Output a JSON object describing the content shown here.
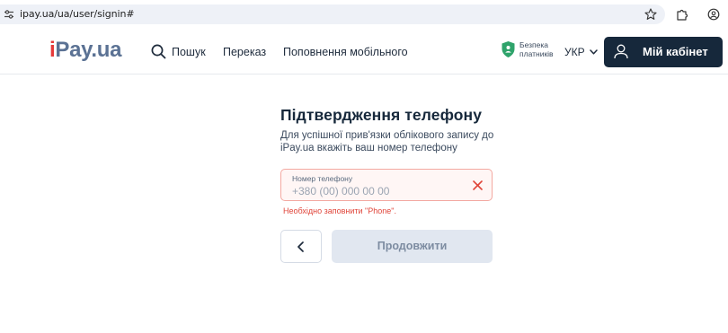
{
  "browser": {
    "url": "ipay.ua/ua/user/signin#"
  },
  "header": {
    "logo_i": "i",
    "logo_rest": "Pay.ua",
    "nav": {
      "search": "Пошук",
      "transfer": "Переказ",
      "topup": "Поповнення мобільного"
    },
    "safety_line1": "Безпека",
    "safety_line2": "платників",
    "language": "УКР",
    "cabinet_label": "Мій кабінет"
  },
  "form": {
    "title": "Підтвердження телефону",
    "description": "Для успішної прив'язки облікового запису до iPay.ua вкажіть ваш номер телефону",
    "phone_label": "Номер телефону",
    "phone_placeholder": "+380 (00) 000 00 00",
    "phone_value": "",
    "error": "Необхідно заповнити \"Phone\".",
    "continue_label": "Продовжити"
  },
  "colors": {
    "brand_dark": "#16283b",
    "logo_blue": "#5b7294",
    "logo_red": "#e63a3a",
    "error": "#e0453a",
    "safety_green": "#2fa36b"
  },
  "icons": [
    "tune-icon",
    "star-icon",
    "extensions-icon",
    "profile-icon",
    "search-icon",
    "shield-icon",
    "chevron-down-icon",
    "user-icon",
    "clear-icon",
    "back-arrow-icon"
  ]
}
